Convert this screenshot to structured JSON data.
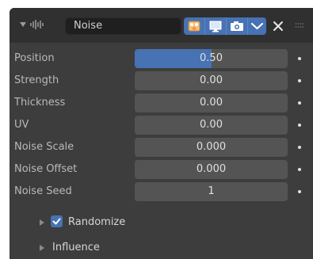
{
  "modifier": {
    "name": "Noise",
    "icons": {
      "collapse": "chevron-down-icon",
      "type": "wave-icon",
      "edit_mode": "edit-mode-icon",
      "viewport": "monitor-icon",
      "render": "camera-icon",
      "dropdown": "chevron-down-icon",
      "close": "close-icon",
      "drag": "drag-handle-icon"
    }
  },
  "properties": [
    {
      "label": "Position",
      "value": "0.50",
      "fill": 0.5
    },
    {
      "label": "Strength",
      "value": "0.00",
      "fill": 0
    },
    {
      "label": "Thickness",
      "value": "0.00",
      "fill": 0
    },
    {
      "label": "UV",
      "value": "0.00",
      "fill": 0
    },
    {
      "label": "Noise Scale",
      "value": "0.000",
      "fill": 0
    },
    {
      "label": "Noise Offset",
      "value": "0.000",
      "fill": 0
    },
    {
      "label": "Noise Seed",
      "value": "1",
      "fill": 0
    }
  ],
  "subpanels": {
    "randomize": {
      "label": "Randomize",
      "checked": true
    },
    "influence": {
      "label": "Influence"
    }
  },
  "colors": {
    "accent": "#4772b3",
    "panel_bg": "#3d3d3d",
    "header_bg": "#303030",
    "field_bg": "#545454"
  }
}
